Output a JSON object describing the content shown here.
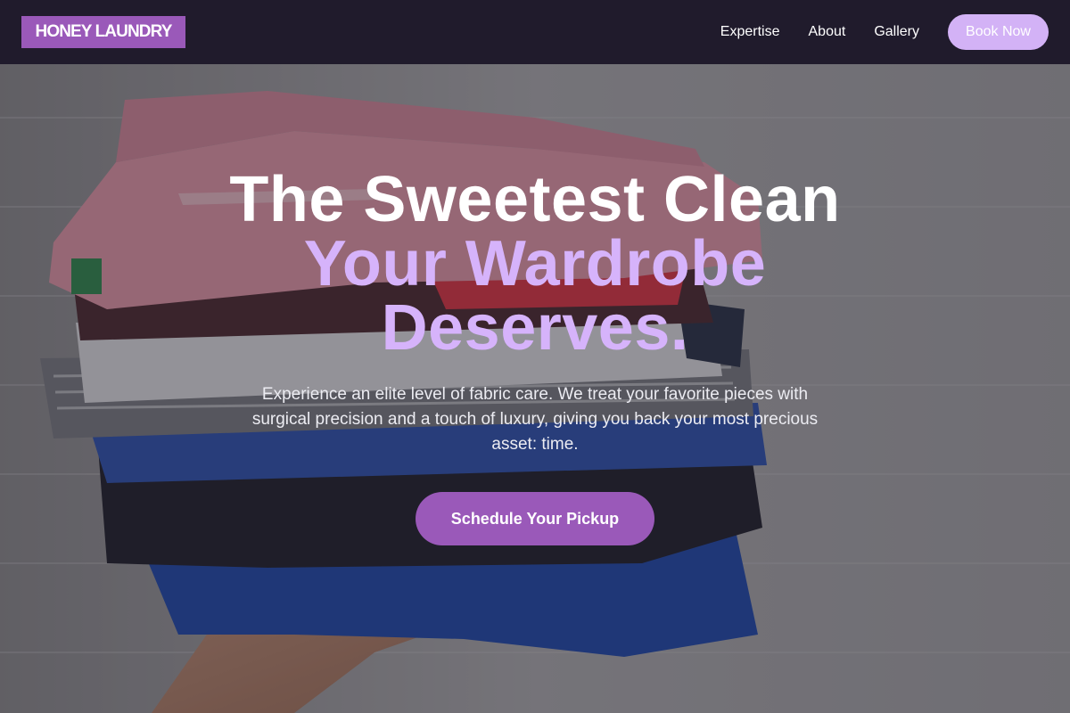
{
  "brand": {
    "logo_text": "HONEY LAUNDRY"
  },
  "nav": {
    "links": [
      {
        "label": "Expertise"
      },
      {
        "label": "About"
      },
      {
        "label": "Gallery"
      }
    ],
    "cta_label": "Book Now"
  },
  "hero": {
    "headline_line1": "The Sweetest Clean",
    "headline_line2": "Your Wardrobe",
    "headline_line3": "Deserves.",
    "subtext": "Experience an elite level of fabric care. We treat your favorite pieces with surgical precision and a touch of luxury, giving you back your most precious asset: time.",
    "cta_label": "Schedule Your Pickup"
  },
  "colors": {
    "nav_background": "#201b2c",
    "brand_purple": "#9a59b9",
    "accent_lavender": "#d3b2f6",
    "headline_accent": "#d6b3fb"
  }
}
